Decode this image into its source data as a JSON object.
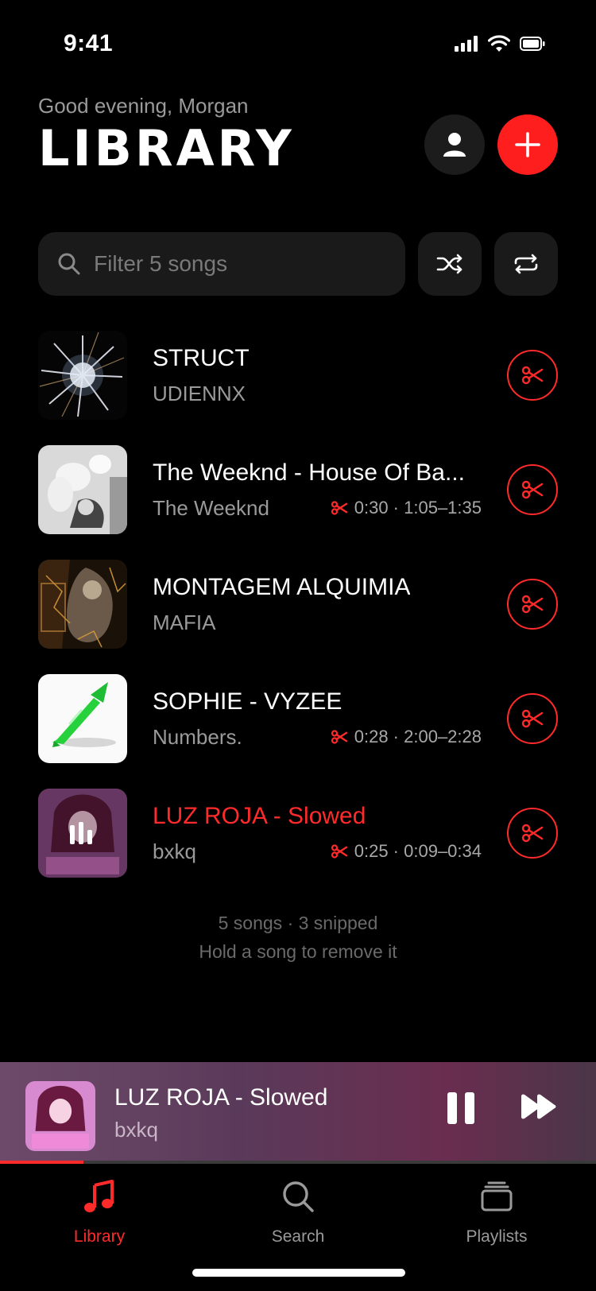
{
  "status": {
    "time": "9:41"
  },
  "header": {
    "greeting": "Good evening, Morgan",
    "title": "LIBRARY",
    "accent": "#ff1e1e"
  },
  "filter": {
    "placeholder": "Filter 5 songs"
  },
  "songs": [
    {
      "title": "STRUCT",
      "artist": "UDIENNX",
      "snip": "",
      "active": false,
      "art": "starburst"
    },
    {
      "title": "The Weeknd - House Of Ba...",
      "artist": "The Weeknd",
      "snip": "0:30 · 1:05–1:35",
      "active": false,
      "art": "bw-photo"
    },
    {
      "title": "MONTAGEM ALQUIMIA",
      "artist": "MAFIA",
      "snip": "",
      "active": false,
      "art": "dark-gold"
    },
    {
      "title": "SOPHIE - VYZEE",
      "artist": "Numbers.",
      "snip": "0:28 · 2:00–2:28",
      "active": false,
      "art": "green-object"
    },
    {
      "title": "LUZ ROJA - Slowed",
      "artist": "bxkq",
      "snip": "0:25 · 0:09–0:34",
      "active": true,
      "art": "pink-anime"
    }
  ],
  "footer": {
    "count": "5 songs · 3 snipped",
    "hint": "Hold a song to remove it"
  },
  "now_playing": {
    "title": "LUZ ROJA - Slowed",
    "artist": "bxkq",
    "progress": 0.14
  },
  "tabs": [
    {
      "label": "Library",
      "icon": "music-note-icon",
      "active": true
    },
    {
      "label": "Search",
      "icon": "search-icon",
      "active": false
    },
    {
      "label": "Playlists",
      "icon": "playlists-icon",
      "active": false
    }
  ]
}
